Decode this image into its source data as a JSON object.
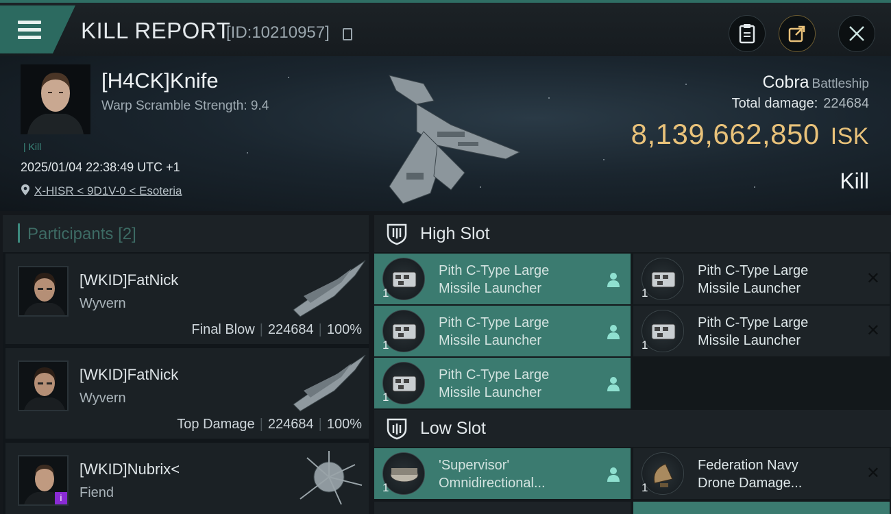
{
  "header": {
    "title": "KILL REPORT",
    "report_id": "[ID:10210957]"
  },
  "victim": {
    "name": "[H4CK]Knife",
    "warp_scramble": "Warp Scramble Strength: 9.4",
    "tag": "Kill",
    "datetime": "2025/01/04 22:38:49 UTC +1",
    "location": "X-HISR < 9D1V-0 < Esoteria",
    "ship": "Cobra",
    "ship_class": "Battleship",
    "total_damage_label": "Total damage:",
    "total_damage": "224684",
    "isk_value": "8,139,662,850",
    "isk_unit": "ISK",
    "result": "Kill"
  },
  "participants": {
    "title": "Participants",
    "count": "[2]",
    "rows": [
      {
        "name": "[WKID]FatNick",
        "ship": "Wyvern",
        "role": "Final Blow",
        "damage": "224684",
        "percent": "100%"
      },
      {
        "name": "[WKID]FatNick",
        "ship": "Wyvern",
        "role": "Top Damage",
        "damage": "224684",
        "percent": "100%"
      },
      {
        "name": "[WKID]Nubrix<",
        "ship": "Fiend",
        "role": "",
        "damage": "",
        "percent": "",
        "badge": "i"
      }
    ]
  },
  "slots": {
    "high": {
      "title": "High Slot",
      "modules": [
        {
          "qty": "1",
          "line1": "Pith C-Type Large",
          "line2": "Missile Launcher",
          "state": "dropped"
        },
        {
          "qty": "1",
          "line1": "Pith C-Type Large",
          "line2": "Missile Launcher",
          "state": "destroyed"
        },
        {
          "qty": "1",
          "line1": "Pith C-Type Large",
          "line2": "Missile Launcher",
          "state": "dropped"
        },
        {
          "qty": "1",
          "line1": "Pith C-Type Large",
          "line2": "Missile Launcher",
          "state": "destroyed"
        },
        {
          "qty": "1",
          "line1": "Pith C-Type Large",
          "line2": "Missile Launcher",
          "state": "dropped"
        }
      ]
    },
    "low": {
      "title": "Low Slot",
      "modules": [
        {
          "qty": "1",
          "line1": "'Supervisor'",
          "line2": "Omnidirectional...",
          "state": "dropped"
        },
        {
          "qty": "1",
          "line1": "Federation Navy",
          "line2": "Drone Damage...",
          "state": "destroyed"
        }
      ]
    }
  },
  "colors": {
    "accent": "#3b7b70",
    "isk_gold": "#e9c27a",
    "badge_purple": "#8a2bd4"
  },
  "icons": [
    "menu-icon",
    "copy-icon",
    "clipboard-icon",
    "share-icon",
    "close-icon",
    "location-pin-icon",
    "slot-shield-icon",
    "person-icon",
    "x-icon"
  ]
}
